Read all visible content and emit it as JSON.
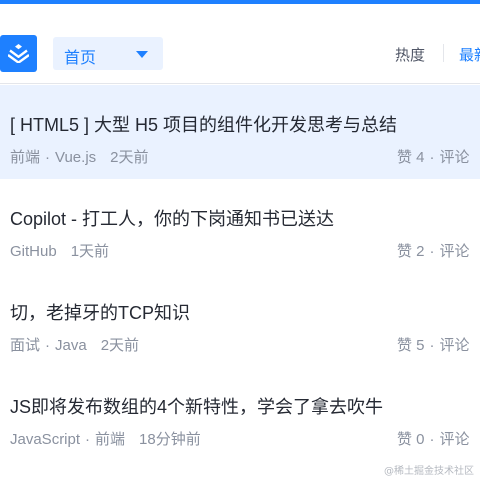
{
  "header": {
    "nav_select": "首页",
    "tabs": [
      {
        "label": "热度"
      },
      {
        "label": "最新"
      }
    ]
  },
  "articles": [
    {
      "title": "[ HTML5 ] 大型 H5 项目的组件化开发思考与总结",
      "tags": [
        "前端",
        "Vue.js"
      ],
      "time": "2天前",
      "likes_label": "赞 4",
      "comments_label": "评论"
    },
    {
      "title": "Copilot - 打工人，你的下岗通知书已送达",
      "tags": [
        "GitHub"
      ],
      "time": "1天前",
      "likes_label": "赞 2",
      "comments_label": "评论"
    },
    {
      "title": "切，老掉牙的TCP知识",
      "tags": [
        "面试",
        "Java"
      ],
      "time": "2天前",
      "likes_label": "赞 5",
      "comments_label": "评论"
    },
    {
      "title": "JS即将发布数组的4个新特性，学会了拿去吹牛",
      "tags": [
        "JavaScript",
        "前端"
      ],
      "time": "18分钟前",
      "likes_label": "赞 0",
      "comments_label": "评论"
    }
  ],
  "watermark": "@稀土掘金技术社区",
  "colors": {
    "accent": "#1e80ff",
    "highlight_bg": "#eaf2ff",
    "meta_text": "#8a919f",
    "title_text": "#252933"
  }
}
